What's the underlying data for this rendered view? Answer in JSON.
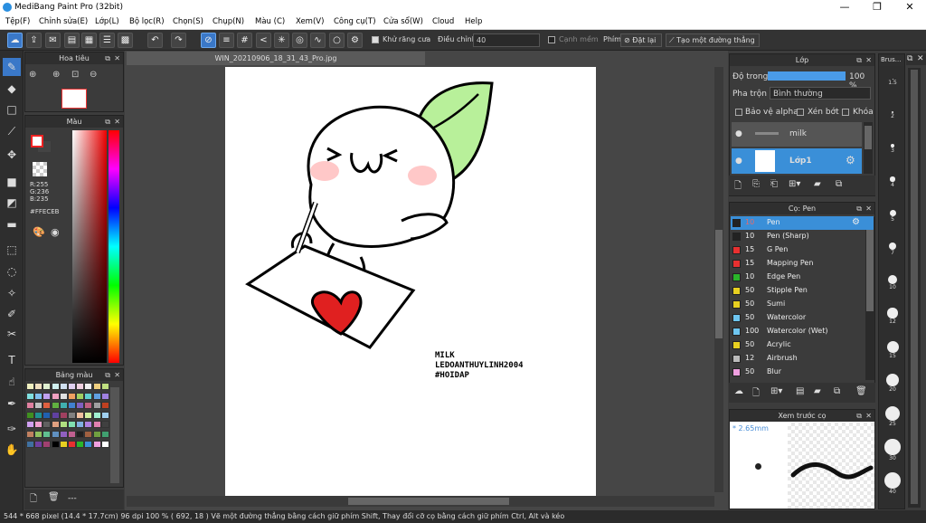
{
  "window": {
    "title": "MediBang Paint Pro (32bit)",
    "min": "—",
    "max": "❐",
    "close": "✕"
  },
  "menu": [
    "Tệp(F)",
    "Chỉnh sửa(E)",
    "Lớp(L)",
    "Bộ lọc(R)",
    "Chọn(S)",
    "Chụp(N)",
    "Màu (C)",
    "Xem(V)",
    "Công cụ(T)",
    "Cửa sổ(W)",
    "Cloud",
    "Help"
  ],
  "toolbar": {
    "antialias": "Khử răng cưa",
    "adjust_label": "Điều chỉnh",
    "adjust_value": "40",
    "edge": "Cạnh mềm",
    "key": "Phím",
    "reset": "Đặt lại",
    "new_line": "Tạo một đường thẳng"
  },
  "navigator": {
    "title": "Hoa tiêu"
  },
  "color": {
    "title": "Màu",
    "r": "R:255",
    "g": "G:236",
    "b": "B:235",
    "hex": "#FFECEB"
  },
  "palette": {
    "title": "Bảng màu",
    "footer": "---"
  },
  "canvas": {
    "tab": "WIN_20210906_18_31_43_Pro.jpg",
    "sig1": "MILK",
    "sig2": "LEDOANTHUYLINH2004",
    "sig3": "#HOIDAP"
  },
  "layer": {
    "title": "Lớp",
    "opacity_label": "Độ trong",
    "opacity_value": "100 %",
    "opacity": 1.0,
    "blend_label": "Pha trộn",
    "blend_value": "Bình thường",
    "protect": "Bảo vệ alpha",
    "clip": "Xén bớt",
    "lock": "Khóa",
    "layers": [
      {
        "name": "milk"
      },
      {
        "name": "Lớp1"
      }
    ]
  },
  "brushes": {
    "title": "Cọ: Pen",
    "items": [
      {
        "size": "10",
        "name": "Pen",
        "color": "#222222"
      },
      {
        "size": "10",
        "name": "Pen (Sharp)",
        "color": "#222222"
      },
      {
        "size": "15",
        "name": "G Pen",
        "color": "#e83030"
      },
      {
        "size": "15",
        "name": "Mapping Pen",
        "color": "#e83030"
      },
      {
        "size": "10",
        "name": "Edge Pen",
        "color": "#2ab52a"
      },
      {
        "size": "50",
        "name": "Stipple Pen",
        "color": "#e8d020"
      },
      {
        "size": "50",
        "name": "Sumi",
        "color": "#e8d020"
      },
      {
        "size": "50",
        "name": "Watercolor",
        "color": "#6ec6f0"
      },
      {
        "size": "100",
        "name": "Watercolor (Wet)",
        "color": "#6ec6f0"
      },
      {
        "size": "50",
        "name": "Acrylic",
        "color": "#e8d020"
      },
      {
        "size": "12",
        "name": "Airbrush",
        "color": "#bbbbbb"
      },
      {
        "size": "50",
        "name": "Blur",
        "color": "#f0a0e0"
      }
    ]
  },
  "preview": {
    "title": "Xem trước cọ",
    "size": "* 2.65mm"
  },
  "brushsize": {
    "title": "Brus...",
    "values": [
      "1.5",
      "2",
      "3",
      "4",
      "5",
      "7",
      "10",
      "12",
      "15",
      "20",
      "25",
      "30",
      "40"
    ]
  },
  "status": {
    "text": "544 * 668 pixel   (14.4 * 17.7cm)   96 dpi   100 %   ( 692, 18 )   Vẽ một đường thẳng bằng cách giữ phím Shift, Thay đổi cỡ cọ bằng cách giữ phím Ctrl, Alt và kéo"
  }
}
